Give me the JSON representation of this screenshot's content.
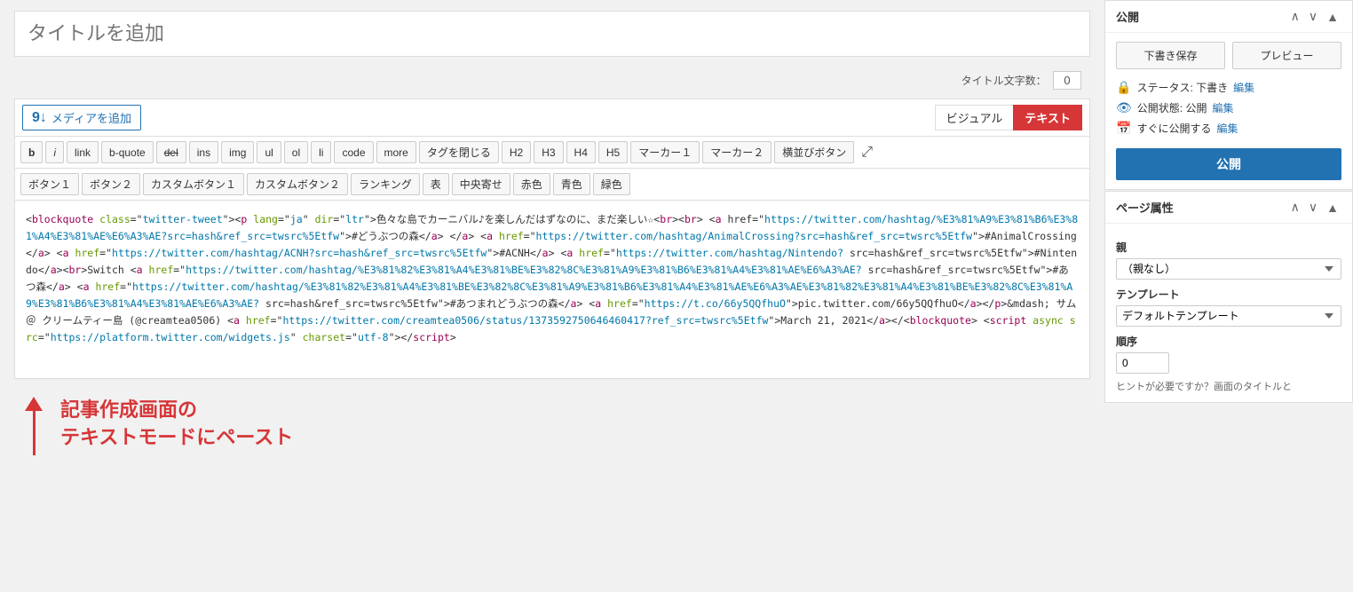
{
  "title_placeholder": "タイトルを追加",
  "char_count_label": "タイトル文字数：",
  "char_count_value": "0",
  "add_media_label": "メディアを追加",
  "mode_visual": "ビジュアル",
  "mode_text": "テキスト",
  "toolbar": {
    "row1": [
      {
        "label": "b",
        "style": "bold"
      },
      {
        "label": "i",
        "style": "italic"
      },
      {
        "label": "link",
        "style": "normal"
      },
      {
        "label": "b-quote",
        "style": "normal"
      },
      {
        "label": "del",
        "style": "del"
      },
      {
        "label": "ins",
        "style": "normal"
      },
      {
        "label": "img",
        "style": "normal"
      },
      {
        "label": "ul",
        "style": "normal"
      },
      {
        "label": "ol",
        "style": "normal"
      },
      {
        "label": "li",
        "style": "normal"
      },
      {
        "label": "code",
        "style": "normal"
      },
      {
        "label": "more",
        "style": "normal"
      },
      {
        "label": "タグを閉じる",
        "style": "normal"
      },
      {
        "label": "H2",
        "style": "normal"
      },
      {
        "label": "H3",
        "style": "normal"
      },
      {
        "label": "H4",
        "style": "normal"
      },
      {
        "label": "H5",
        "style": "normal"
      },
      {
        "label": "マーカー１",
        "style": "normal"
      },
      {
        "label": "マーカー２",
        "style": "normal"
      },
      {
        "label": "横並びボタン",
        "style": "normal"
      }
    ],
    "row2": [
      {
        "label": "ボタン１"
      },
      {
        "label": "ボタン２"
      },
      {
        "label": "カスタムボタン１"
      },
      {
        "label": "カスタムボタン２"
      },
      {
        "label": "ランキング"
      },
      {
        "label": "表"
      },
      {
        "label": "中央寄せ"
      },
      {
        "label": "赤色"
      },
      {
        "label": "青色"
      },
      {
        "label": "緑色"
      }
    ]
  },
  "editor_content": "<blockquote class=\"twitter-tweet\"><p lang=\"ja\" dir=\"ltr\">色々な島でカーニバル♪を楽しんだはずなのに、まだ楽しい☆<br><br> <a href=\"https://twitter.com/hashtag/%E3%81%A9%E3%81%B6%E3%81%A4%E3%81%AE%E6%A3%AE?src=hash&amp;ref_src=twsrc%5Etfw\">#どうぶつの森</a> <a href=\"https://twitter.com/hashtag/AnimalCrossing?src=hash&amp;ref_src=twsrc%5Etfw\">#AnimalCrossing</a> <a href=\"https://twitter.com/hashtag/ACNH?src=hash&amp;ref_src=twsrc%5Etfw\">#ACNH</a> <a href=\"https://twitter.com/hashtag/Nintendo?src=hash&amp;ref_src=twsrc%5Etfw\">#Nintendo</a><br>Switch <a href=\"https://twitter.com/hashtag/%E3%81%82%E3%81%A4%E3%81%BE%E3%82%8C%E3%81%A9%E3%81%B6%E3%81%A4%E3%81%AE%E6%A3%AE?src=hash&amp;ref_src=twsrc%5Etfw\">#あつ森</a> <a href=\"https://twitter.com/hashtag/%E3%81%82%E3%81%A4%E3%81%BE%E3%82%8C%E3%81%A9%E3%81%B6%E3%81%A4%E3%81%AE%E6%A3%AE?src=hash&amp;ref_src=twsrc%5Etfw\">#あつまれどうぶつの森</a> <a href=\"https://t.co/66y5QQfhuO\">pic.twitter.com/66y5QQfhuO</a></p>&mdash; サム＠クリームティー島 (@creamtea0506) <a href=\"https://twitter.com/creamtea0506/status/1373592750646460417?ref_src=twsrc%5Etfw\">March 21, 2021</a></blockquote> <script async src=\"https://platform.twitter.com/widgets.js\" charset=\"utf-8\"><\\/script>",
  "annotation_text": "記事作成画面の\nテキストモードにペースト",
  "sidebar": {
    "publish_panel": {
      "title": "公開",
      "draft_save": "下書き保存",
      "preview": "プレビュー",
      "status_label": "ステータス: 下書き",
      "status_edit": "編集",
      "visibility_label": "公開状態: 公開",
      "visibility_edit": "編集",
      "schedule_label": "すぐに公開する",
      "schedule_edit": "編集",
      "publish_btn": "公開"
    },
    "page_attr_panel": {
      "title": "ページ属性",
      "parent_label": "親",
      "parent_options": [
        "（親なし）"
      ],
      "parent_selected": "（親なし）",
      "template_label": "テンプレート",
      "template_options": [
        "デフォルトテンプレート"
      ],
      "template_selected": "デフォルトテンプレート",
      "order_label": "順序",
      "order_value": "0",
      "hint_text": "ヒントが必要ですか？画面のタイトルと"
    }
  }
}
